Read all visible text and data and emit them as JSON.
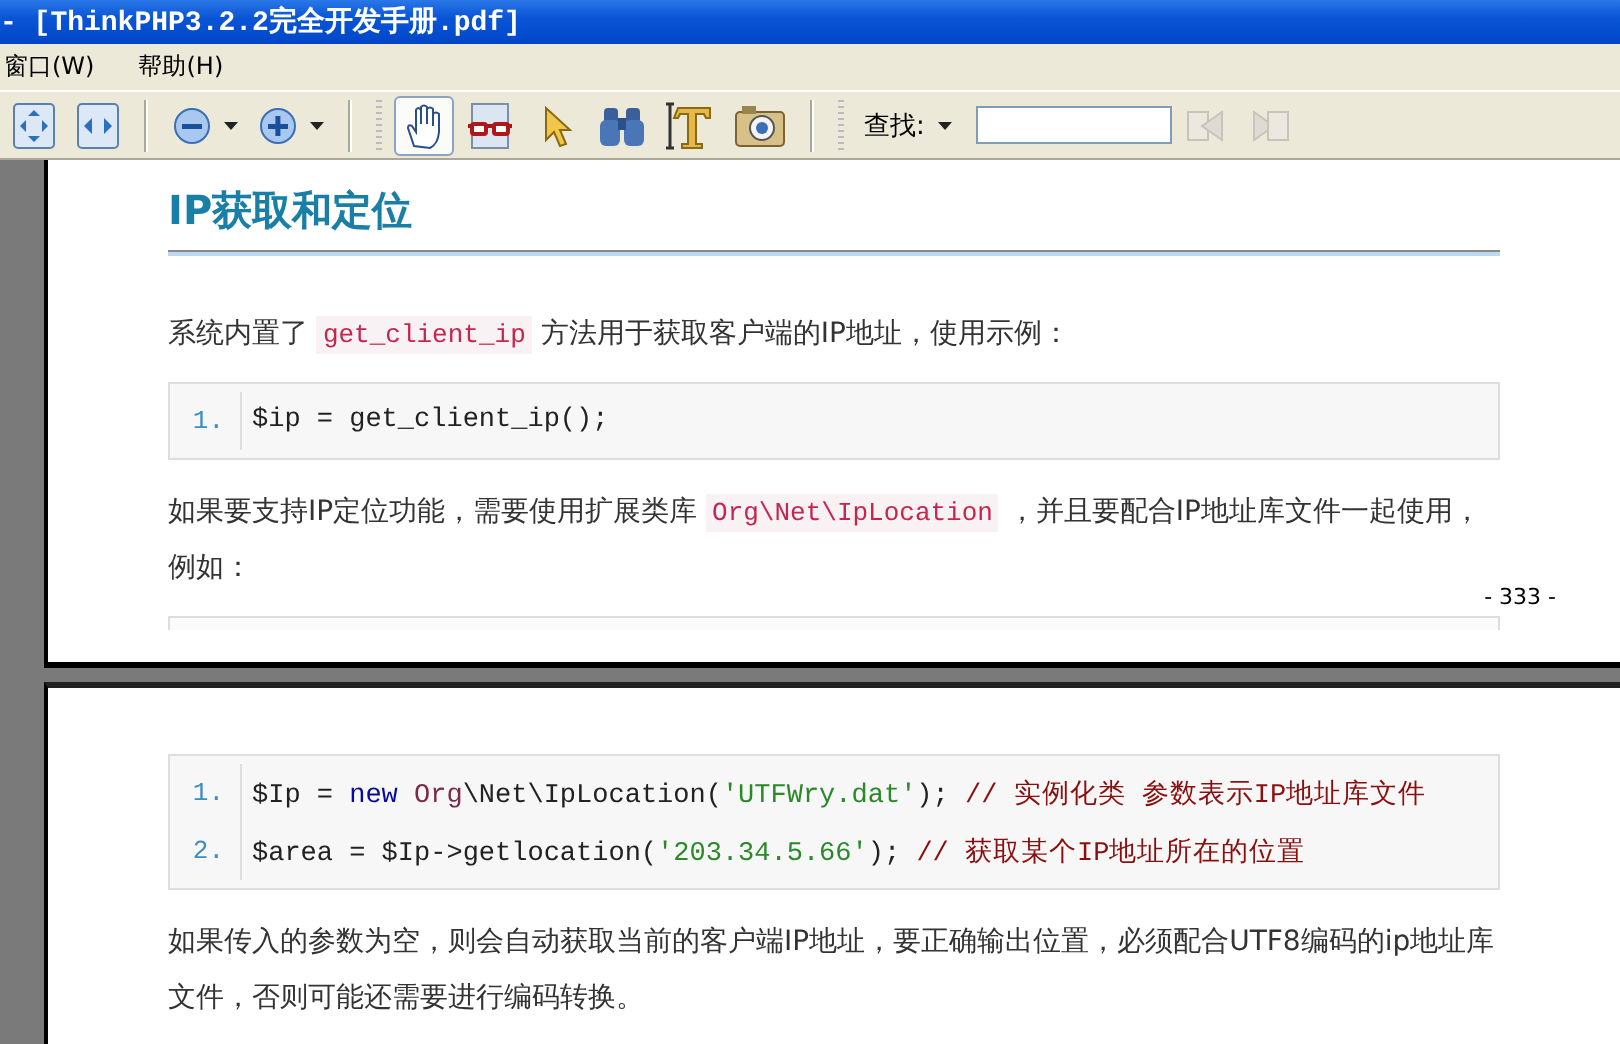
{
  "window": {
    "title": "- [ThinkPHP3.2.2完全开发手册.pdf]"
  },
  "menu": [
    "窗口(W)",
    "帮助(H)"
  ],
  "toolbar": {
    "tools": [
      {
        "kind": "fit-page",
        "selected": false
      },
      {
        "kind": "fit-width",
        "selected": false
      },
      {
        "kind": "zoom-out",
        "selected": false
      },
      {
        "kind": "zoom-in",
        "selected": false
      },
      {
        "kind": "hand",
        "selected": true
      },
      {
        "kind": "glasses",
        "selected": false
      },
      {
        "kind": "pointer",
        "selected": false
      },
      {
        "kind": "binoculars",
        "selected": false
      },
      {
        "kind": "text-select",
        "selected": false
      },
      {
        "kind": "camera",
        "selected": false
      }
    ],
    "find_label": "查找:",
    "find_prev_disabled": true,
    "find_next_disabled": true
  },
  "pages": [
    {
      "blocks": [
        {
          "kind": "heading",
          "text": "IP获取和定位"
        },
        {
          "kind": "paragraph",
          "parts": [
            {
              "kind": "text",
              "text": "系统内置了 "
            },
            {
              "kind": "code",
              "text": "get_client_ip"
            },
            {
              "kind": "text",
              "text": " 方法用于获取客户端的IP地址，使用示例："
            }
          ]
        },
        {
          "kind": "code",
          "lines": [
            {
              "number": "1.",
              "tokens": [
                {
                  "kind": "plain",
                  "text": "$ip = get_client_ip();"
                }
              ]
            }
          ]
        },
        {
          "kind": "paragraph",
          "parts": [
            {
              "kind": "text",
              "text": "如果要支持IP定位功能，需要使用扩展类库 "
            },
            {
              "kind": "code",
              "text": "Org\\Net\\IpLocation"
            },
            {
              "kind": "text",
              "text": " ，并且要配合IP地址库文件一起使用，例如："
            }
          ]
        },
        {
          "kind": "code-start"
        }
      ],
      "footer": "- 333 -"
    },
    {
      "blocks": [
        {
          "kind": "code",
          "lines": [
            {
              "number": "1.",
              "tokens": [
                {
                  "kind": "plain",
                  "text": "$Ip = "
                },
                {
                  "kind": "keyword",
                  "text": "new "
                },
                {
                  "kind": "class",
                  "text": "Org"
                },
                {
                  "kind": "plain",
                  "text": "\\Net\\IpLocation("
                },
                {
                  "kind": "string",
                  "text": "'UTFWry.dat'"
                },
                {
                  "kind": "plain",
                  "text": "); "
                },
                {
                  "kind": "comment",
                  "text": "// 实例化类 参数表示IP地址库文件"
                }
              ]
            },
            {
              "number": "2.",
              "tokens": [
                {
                  "kind": "plain",
                  "text": "$area = $Ip->getlocation("
                },
                {
                  "kind": "string",
                  "text": "'203.34.5.66'"
                },
                {
                  "kind": "plain",
                  "text": "); "
                },
                {
                  "kind": "comment",
                  "text": "// 获取某个IP地址所在的位置"
                }
              ]
            }
          ]
        },
        {
          "kind": "paragraph",
          "parts": [
            {
              "kind": "text",
              "text": "如果传入的参数为空，则会自动获取当前的客户端IP地址，要正确输出位置，必须配合UTF8编码的ip地址库文件，否则可能还需要进行编码转换。"
            }
          ]
        }
      ]
    }
  ]
}
